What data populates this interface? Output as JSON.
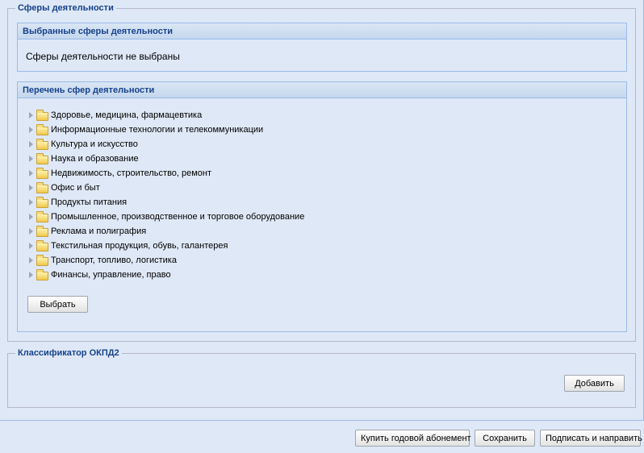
{
  "spheres": {
    "legend": "Сферы деятельности",
    "selected_panel": {
      "title": "Выбранные сферы деятельности",
      "empty_text": "Сферы деятельности не выбраны"
    },
    "list_panel": {
      "title": "Перечень сфер деятельности",
      "items": [
        "Здоровье, медицина, фармацевтика",
        "Информационные технологии и телекоммуникации",
        "Культура и искусство",
        "Наука и образование",
        "Недвижимость, строительство, ремонт",
        "Офис и быт",
        "Продукты питания",
        "Промышленное, производственное и торговое оборудование",
        "Реклама и полиграфия",
        "Текстильная продукция, обувь, галантерея",
        "Транспорт, топливо, логистика",
        "Финансы, управление, право"
      ],
      "select_label": "Выбрать"
    }
  },
  "okpd": {
    "legend": "Классификатор ОКПД2",
    "add_label": "Добавить"
  },
  "footer": {
    "buy_label": "Купить годовой абонемент",
    "save_label": "Сохранить",
    "sign_label": "Подписать и направить"
  }
}
